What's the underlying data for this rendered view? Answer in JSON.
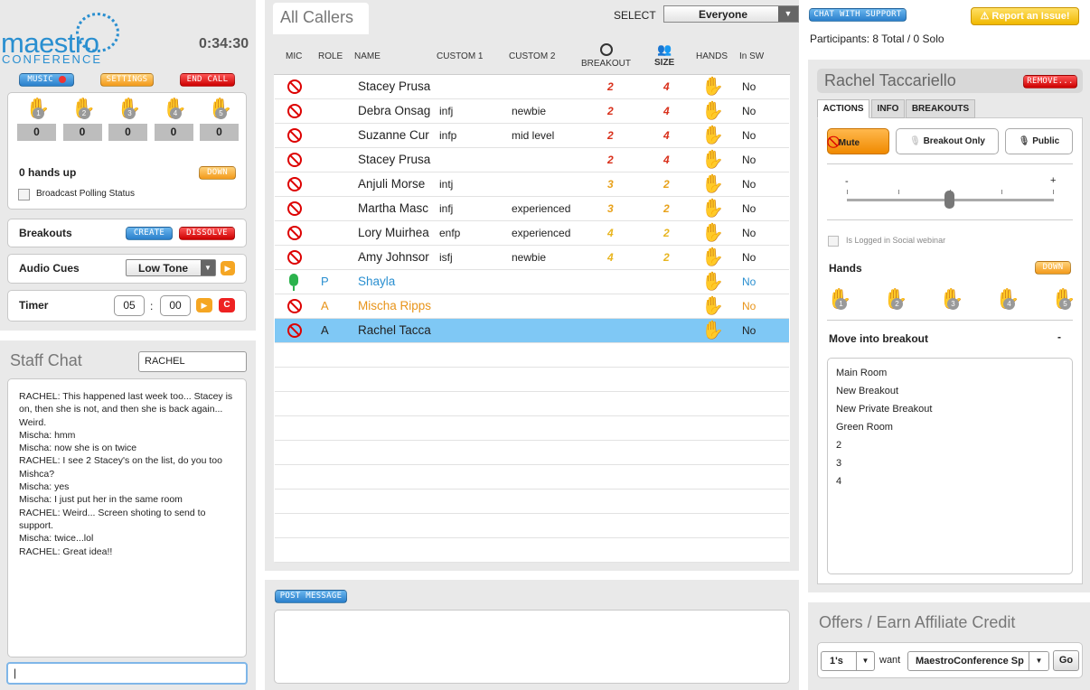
{
  "app": {
    "logo_main": "maestro",
    "logo_sub": "CONFERENCE",
    "timer": "0:34:30"
  },
  "left": {
    "music_label": "MUSIC",
    "settings_label": "SETTINGS",
    "end_call_label": "END CALL",
    "hand_counts": [
      "0",
      "0",
      "0",
      "0",
      "0"
    ],
    "hands_up": "0 hands up",
    "down_label": "DOWN",
    "broadcast_label": "Broadcast Polling Status",
    "breakouts_label": "Breakouts",
    "create_label": "CREATE",
    "dissolve_label": "DISSOLVE",
    "audio_cues_label": "Audio Cues",
    "audio_cue_value": "Low Tone",
    "timer_label": "Timer",
    "timer_min": "05",
    "timer_sep": ":",
    "timer_sec": "00"
  },
  "staff_chat": {
    "title": "Staff Chat",
    "name_value": "RACHEL",
    "messages": [
      "RACHEL: This happened last week too... Stacey is on, then she is not, and then she is back again... Weird.",
      "Mischa: hmm",
      "Mischa: now she is on twice",
      "RACHEL: I see 2 Stacey's on the list, do you too Mishca?",
      "Mischa: yes",
      "Mischa: I just put her in the same room",
      "RACHEL: Weird... Screen shoting to send to support.",
      "Mischa: twice...lol",
      "RACHEL: Great idea!!"
    ],
    "input_value": "|"
  },
  "callers": {
    "tab_title": "All Callers",
    "select_label": "SELECT",
    "select_value": "Everyone",
    "columns": {
      "mic": "MIC",
      "role": "ROLE",
      "name": "NAME",
      "custom1": "CUSTOM 1",
      "custom2": "CUSTOM 2",
      "breakout": "BREAKOUT",
      "size": "SIZE",
      "hands": "HANDS",
      "insw": "In SW"
    },
    "rows": [
      {
        "role": "",
        "name": "Stacey Prusa",
        "c1": "",
        "c2": "",
        "breakout": "2",
        "size": "4",
        "insw": "No",
        "color": "#222",
        "bcolor": "#d9301b",
        "mic": "muted",
        "selected": false
      },
      {
        "role": "",
        "name": "Debra Onsag",
        "c1": "infj",
        "c2": "newbie",
        "breakout": "2",
        "size": "4",
        "insw": "No",
        "color": "#222",
        "bcolor": "#d9301b",
        "mic": "muted",
        "selected": false
      },
      {
        "role": "",
        "name": "Suzanne Cur",
        "c1": "infp",
        "c2": "mid level",
        "breakout": "2",
        "size": "4",
        "insw": "No",
        "color": "#222",
        "bcolor": "#d9301b",
        "mic": "muted",
        "selected": false
      },
      {
        "role": "",
        "name": "Stacey Prusa",
        "c1": "",
        "c2": "",
        "breakout": "2",
        "size": "4",
        "insw": "No",
        "color": "#222",
        "bcolor": "#d9301b",
        "mic": "muted",
        "selected": false
      },
      {
        "role": "",
        "name": "Anjuli Morse",
        "c1": "intj",
        "c2": "",
        "breakout": "3",
        "size": "2",
        "insw": "No",
        "color": "#222",
        "bcolor": "#e8a11a",
        "mic": "muted",
        "selected": false
      },
      {
        "role": "",
        "name": "Martha Masc",
        "c1": "infj",
        "c2": "experienced",
        "breakout": "3",
        "size": "2",
        "insw": "No",
        "color": "#222",
        "bcolor": "#e8a11a",
        "mic": "muted",
        "selected": false
      },
      {
        "role": "",
        "name": "Lory Muirhea",
        "c1": "enfp",
        "c2": "experienced",
        "breakout": "4",
        "size": "2",
        "insw": "No",
        "color": "#222",
        "bcolor": "#e8b520",
        "mic": "muted",
        "selected": false
      },
      {
        "role": "",
        "name": "Amy Johnsor",
        "c1": "isfj",
        "c2": "newbie",
        "breakout": "4",
        "size": "2",
        "insw": "No",
        "color": "#222",
        "bcolor": "#e8b520",
        "mic": "muted",
        "selected": false
      },
      {
        "role": "P",
        "name": "Shayla",
        "c1": "",
        "c2": "",
        "breakout": "",
        "size": "",
        "insw": "No",
        "color": "#2a8fd0",
        "bcolor": "#222",
        "mic": "live",
        "selected": false
      },
      {
        "role": "A",
        "name": "Mischa Ripps",
        "c1": "",
        "c2": "",
        "breakout": "",
        "size": "",
        "insw": "No",
        "color": "#e8941a",
        "bcolor": "#222",
        "mic": "muted",
        "selected": false
      },
      {
        "role": "A",
        "name": "Rachel Tacca",
        "c1": "",
        "c2": "",
        "breakout": "",
        "size": "",
        "insw": "No",
        "color": "#222",
        "bcolor": "#222",
        "mic": "muted",
        "selected": true
      }
    ],
    "post_label": "POST MESSAGE"
  },
  "right": {
    "support_label": "CHAT WITH SUPPORT",
    "report_label": "Report an Issue!",
    "participants": "Participants: 8 Total / 0 Solo",
    "selected_name": "Rachel Taccariello",
    "remove_label": "REMOVE...",
    "tabs": [
      "ACTIONS",
      "INFO",
      "BREAKOUTS"
    ],
    "mute_label": "Mute",
    "breakout_only_label": "Breakout Only",
    "public_label": "Public",
    "slider_minus": "-",
    "slider_plus": "+",
    "logged_label": "Is Logged in Social webinar",
    "hands_label": "Hands",
    "down_label": "DOWN",
    "move_label": "Move into breakout",
    "move_toggle": "-",
    "breakout_list": [
      "Main Room",
      "New Breakout",
      "New Private Breakout",
      "Green Room",
      "2",
      "3",
      "4"
    ],
    "offers_title": "Offers / Earn Affiliate Credit",
    "qty_value": "1's",
    "want_label": "want",
    "product_value": "MaestroConference Sp",
    "go_label": "Go"
  },
  "colors": {
    "accent_blue": "#2a8fd0",
    "selected_row": "#7fc8f5",
    "alert_red": "#d9301b"
  }
}
